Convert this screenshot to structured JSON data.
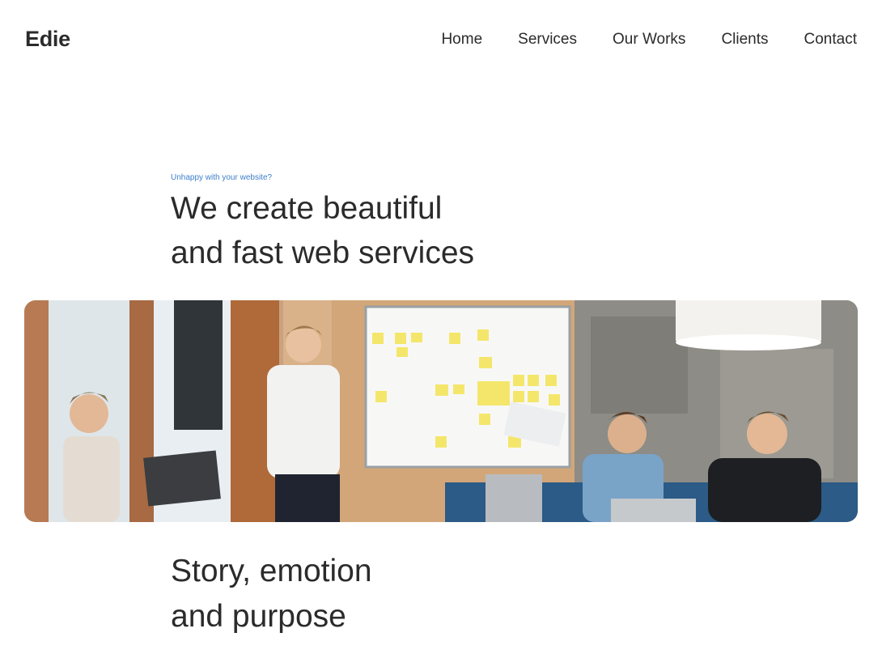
{
  "header": {
    "logo": "Edie",
    "nav": [
      {
        "label": "Home"
      },
      {
        "label": "Services"
      },
      {
        "label": "Our Works"
      },
      {
        "label": "Clients"
      },
      {
        "label": "Contact"
      }
    ]
  },
  "hero": {
    "eyebrow": "Unhappy with your website?",
    "headline_line1": "We create beautiful",
    "headline_line2": "and fast web services",
    "image_alt": "team-meeting-photo"
  },
  "section2": {
    "heading_line1": "Story, emotion",
    "heading_line2": "and purpose"
  },
  "colors": {
    "text": "#2b2b2b",
    "accent": "#3d7fc9",
    "background": "#ffffff"
  }
}
